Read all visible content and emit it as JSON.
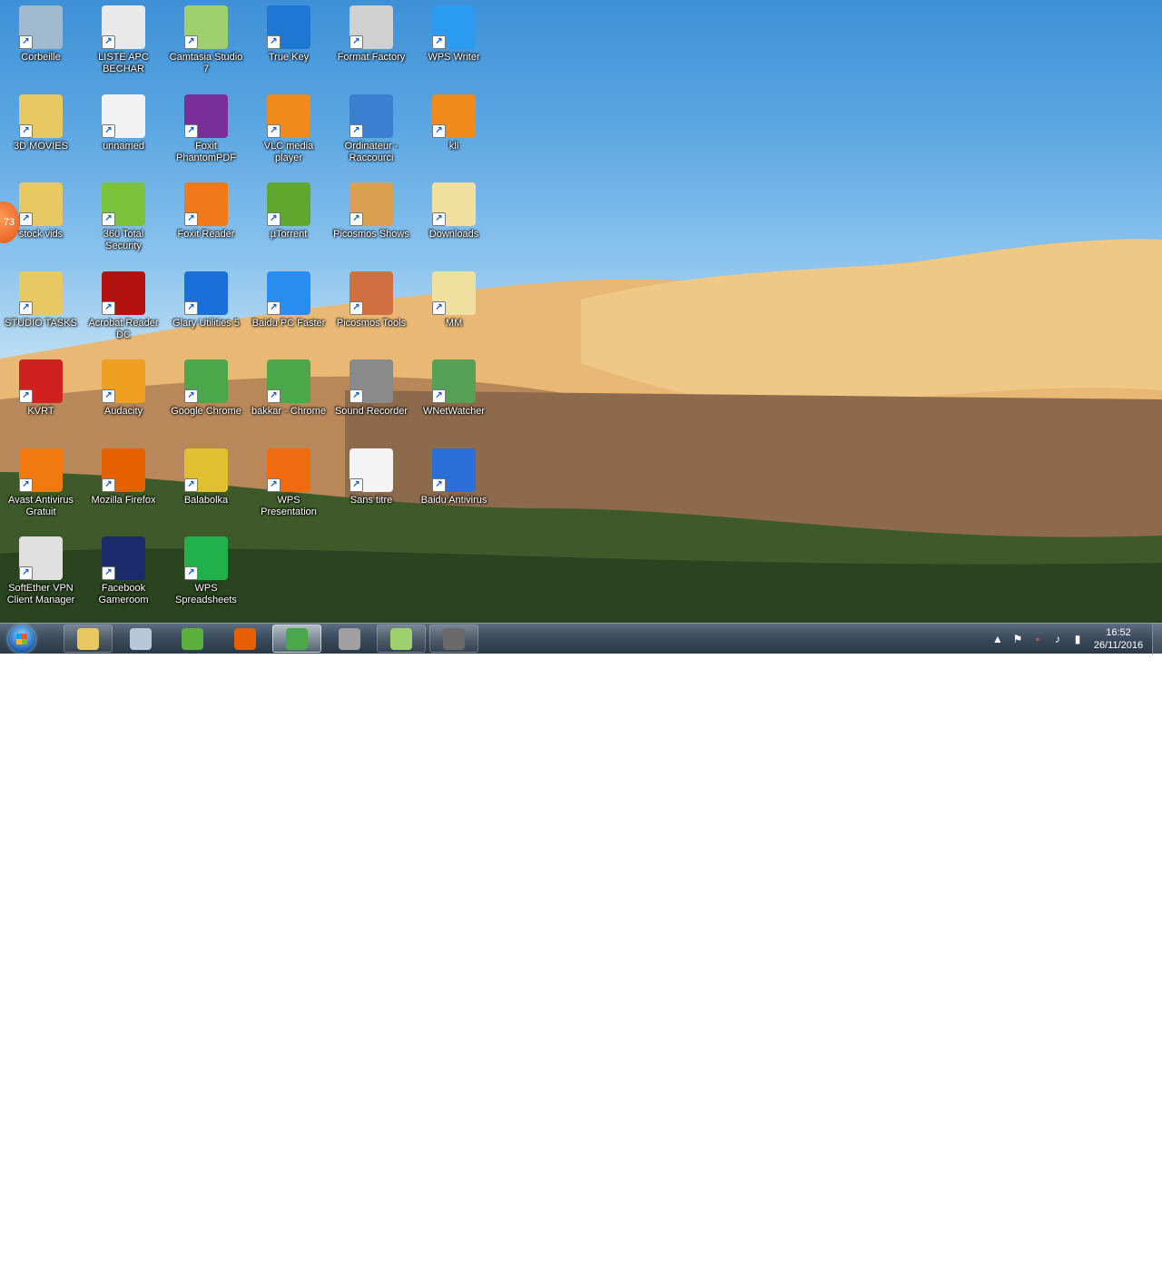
{
  "desktop": {
    "icons": [
      {
        "label": "Corbeille",
        "icon": "recycle-bin-icon",
        "color": "#9fb9cf"
      },
      {
        "label": "LISTE APC BECHAR",
        "icon": "spreadsheet-file-icon",
        "color": "#e9e9e9"
      },
      {
        "label": "Camtasia Studio 7",
        "icon": "camtasia-icon",
        "color": "#9fd06e"
      },
      {
        "label": "True Key",
        "icon": "true-key-icon",
        "color": "#1e78d3"
      },
      {
        "label": "Format Factory",
        "icon": "format-factory-icon",
        "color": "#d0d0d0"
      },
      {
        "label": "WPS Writer",
        "icon": "wps-writer-icon",
        "color": "#2a9bf0"
      },
      {
        "label": "3D MOVIES",
        "icon": "folder-icon",
        "color": "#e8c862"
      },
      {
        "label": "unnamed",
        "icon": "image-file-icon",
        "color": "#f2f2f2"
      },
      {
        "label": "Foxit PhantomPDF",
        "icon": "foxit-phantompdf-icon",
        "color": "#7a2e9a"
      },
      {
        "label": "VLC media player",
        "icon": "vlc-icon",
        "color": "#f08a1a"
      },
      {
        "label": "Ordinateur - Raccourci",
        "icon": "computer-icon",
        "color": "#3a7fd0"
      },
      {
        "label": "kll",
        "icon": "vlc-icon",
        "color": "#f08a1a"
      },
      {
        "label": "stock vids",
        "icon": "folder-icon",
        "color": "#e8c862"
      },
      {
        "label": "360 Total Security",
        "icon": "360-security-icon",
        "color": "#7bc23b"
      },
      {
        "label": "Foxit Reader",
        "icon": "foxit-reader-icon",
        "color": "#f07a1a"
      },
      {
        "label": "µTorrent",
        "icon": "utorrent-icon",
        "color": "#5fa830"
      },
      {
        "label": "Picosmos Shows",
        "icon": "picosmos-shows-icon",
        "color": "#d8a050"
      },
      {
        "label": "Downloads",
        "icon": "folder-icon",
        "color": "#f0e0a0"
      },
      {
        "label": "STUDIO TASKS",
        "icon": "folder-icon",
        "color": "#e8c862"
      },
      {
        "label": "Acrobat Reader DC",
        "icon": "acrobat-icon",
        "color": "#b31010"
      },
      {
        "label": "Glary Utilities 5",
        "icon": "glary-utilities-icon",
        "color": "#1a6fd8"
      },
      {
        "label": "Baidu PC Faster",
        "icon": "baidu-pc-faster-icon",
        "color": "#2a8ef0"
      },
      {
        "label": "Picosmos Tools",
        "icon": "picosmos-tools-icon",
        "color": "#d07040"
      },
      {
        "label": "MM",
        "icon": "folder-icon",
        "color": "#f0e0a0"
      },
      {
        "label": "KVRT",
        "icon": "kvrt-icon",
        "color": "#d02020"
      },
      {
        "label": "Audacity",
        "icon": "audacity-icon",
        "color": "#f0a020"
      },
      {
        "label": "Google Chrome",
        "icon": "chrome-icon",
        "color": "#4aa84a"
      },
      {
        "label": "bakkar - Chrome",
        "icon": "chrome-icon",
        "color": "#4aa84a"
      },
      {
        "label": "Sound Recorder",
        "icon": "microphone-icon",
        "color": "#8a8a8a"
      },
      {
        "label": "WNetWatcher",
        "icon": "wnetwatcher-icon",
        "color": "#55a055"
      },
      {
        "label": "Avast Antivirus Gratuit",
        "icon": "avast-icon",
        "color": "#f07a10"
      },
      {
        "label": "Mozilla Firefox",
        "icon": "firefox-icon",
        "color": "#e66000"
      },
      {
        "label": "Balabolka",
        "icon": "balabolka-icon",
        "color": "#e0c030"
      },
      {
        "label": "WPS Presentation",
        "icon": "wps-presentation-icon",
        "color": "#f06a10"
      },
      {
        "label": "Sans titre",
        "icon": "wma-file-icon",
        "color": "#f4f4f4"
      },
      {
        "label": "Baidu Antivirus",
        "icon": "baidu-antivirus-icon",
        "color": "#2a6fd8"
      },
      {
        "label": "SoftEther VPN Client Manager",
        "icon": "softether-icon",
        "color": "#e0e0e0"
      },
      {
        "label": "Facebook Gameroom",
        "icon": "facebook-gameroom-icon",
        "color": "#1a2a6a"
      },
      {
        "label": "WPS Spreadsheets",
        "icon": "wps-spreadsheets-icon",
        "color": "#22b04a"
      }
    ],
    "notification_badge": "73"
  },
  "taskbar": {
    "buttons": [
      {
        "name": "explorer",
        "icon": "folder-icon",
        "color": "#e8c862",
        "state": "pinned"
      },
      {
        "name": "calculator",
        "icon": "calculator-icon",
        "color": "#b8c8d8",
        "state": "plain"
      },
      {
        "name": "sync",
        "icon": "sync-icon",
        "color": "#5ab03a",
        "state": "plain"
      },
      {
        "name": "firefox",
        "icon": "firefox-icon",
        "color": "#e66000",
        "state": "plain"
      },
      {
        "name": "chrome",
        "icon": "chrome-icon",
        "color": "#4aa84a",
        "state": "active"
      },
      {
        "name": "media",
        "icon": "film-reel-icon",
        "color": "#a0a0a0",
        "state": "plain"
      },
      {
        "name": "camtasia",
        "icon": "camtasia-icon",
        "color": "#9fd06e",
        "state": "pinned"
      },
      {
        "name": "recorder",
        "icon": "camera-icon",
        "color": "#6a6a6a",
        "state": "pinned"
      }
    ],
    "clock": {
      "time": "16:52",
      "date": "26/11/2016"
    }
  }
}
